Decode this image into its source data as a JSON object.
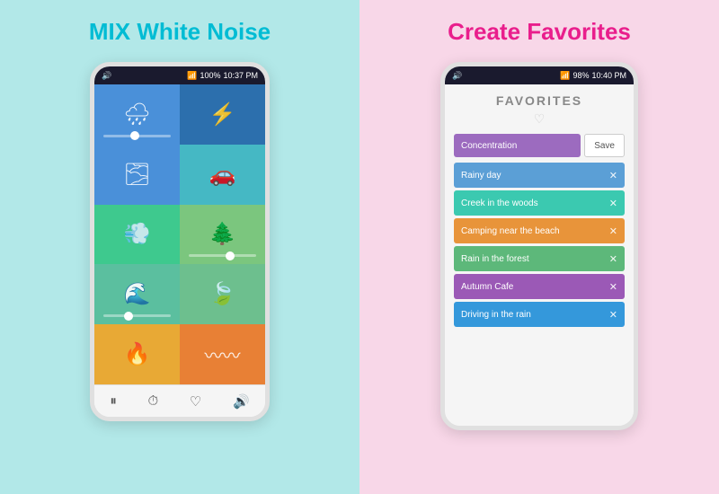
{
  "left": {
    "title": "MIX White Noise",
    "status_bar": {
      "left": "🔊",
      "signal": "📶",
      "battery": "100%",
      "time": "10:37 PM"
    },
    "cells": [
      {
        "icon": "🌧",
        "color": "c1",
        "has_slider": true
      },
      {
        "icon": "⚡",
        "color": "c2",
        "has_slider": false
      },
      {
        "icon": "🌫",
        "color": "c3",
        "has_slider": false
      },
      {
        "icon": "🚗",
        "color": "c4",
        "has_slider": false
      },
      {
        "icon": "💨",
        "color": "c5",
        "has_slider": false
      },
      {
        "icon": "🌲",
        "color": "c6",
        "has_slider": true
      },
      {
        "icon": "🌊",
        "color": "c7",
        "has_slider": true
      },
      {
        "icon": "🍃",
        "color": "c8",
        "has_slider": false
      },
      {
        "icon": "🔥",
        "color": "c9",
        "has_slider": false
      },
      {
        "icon": "〰",
        "color": "c10",
        "has_slider": false
      }
    ],
    "bottom_icons": [
      "⏸",
      "⏱",
      "♡",
      "🔊"
    ]
  },
  "right": {
    "title": "Create Favorites",
    "status_bar": {
      "left": "🔊",
      "signal": "📶",
      "battery": "98%",
      "time": "10:40 PM"
    },
    "screen": {
      "heading": "FAVORITES",
      "input_placeholder": "Concentration",
      "save_label": "Save",
      "items": [
        {
          "label": "Rainy day",
          "color": "fi1"
        },
        {
          "label": "Creek in the woods",
          "color": "fi2"
        },
        {
          "label": "Camping near the beach",
          "color": "fi3"
        },
        {
          "label": "Rain in the forest",
          "color": "fi4"
        },
        {
          "label": "Autumn Cafe",
          "color": "fi5"
        },
        {
          "label": "Driving in the rain",
          "color": "fi6"
        }
      ]
    }
  }
}
